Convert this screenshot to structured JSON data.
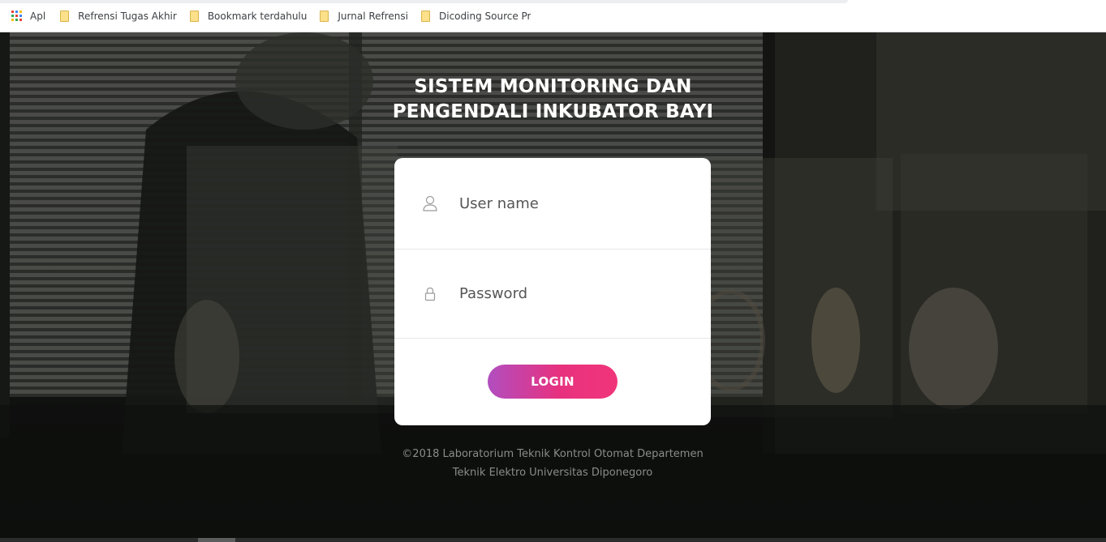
{
  "bookmarks_bar": {
    "apps_label": "Apl",
    "items": [
      {
        "label": "Refrensi Tugas Akhir"
      },
      {
        "label": "Bookmark terdahulu"
      },
      {
        "label": "Jurnal Refrensi"
      },
      {
        "label": "Dicoding Source Projects"
      }
    ]
  },
  "page": {
    "title_line1": "SISTEM MONITORING DAN",
    "title_line2": "PENGENDALI INKUBATOR BAYI"
  },
  "login_form": {
    "username_placeholder": "User name",
    "username_value": "",
    "password_placeholder": "Password",
    "password_value": "",
    "login_label": "LOGIN",
    "user_icon": "user-icon",
    "lock_icon": "lock-icon"
  },
  "footer": {
    "line1": "©2018 Laboratorium Teknik Kontrol Otomat Departemen",
    "line2": "Teknik Elektro Universitas Diponegoro"
  },
  "colors": {
    "button_gradient_start": "#b14ec0",
    "button_gradient_end": "#f1357a",
    "title_text": "#ffffff",
    "footer_text": "#8a8c88"
  }
}
